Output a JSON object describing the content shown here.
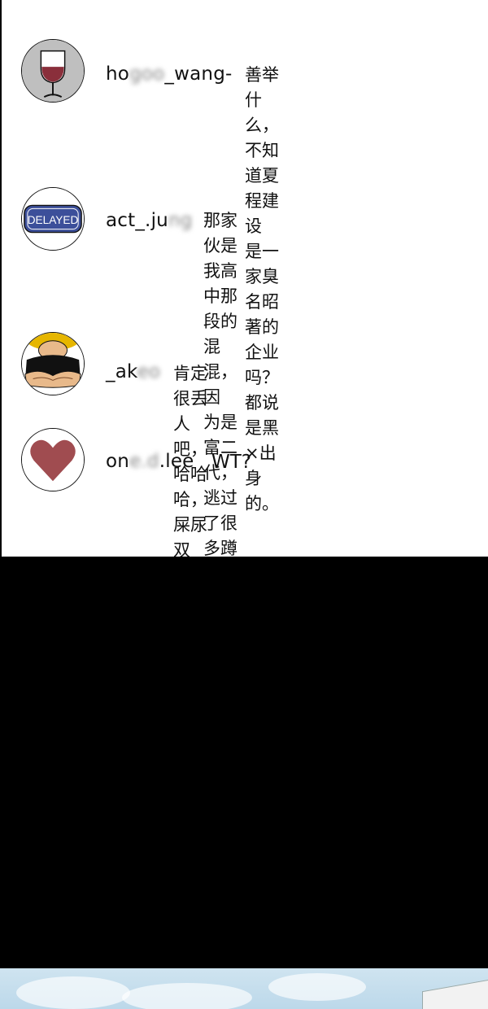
{
  "comments": [
    {
      "avatar_icon": "wine-glass-icon",
      "user_visible_start": "ho",
      "user_blurred": "goo",
      "user_visible_end": "_wang-",
      "text": "善举什么，不知道夏程建设\n是一家臭名昭著的企业吗？\n都说是黑×出身的。"
    },
    {
      "avatar_icon": "delayed-badge-icon",
      "avatar_label": "DELAYED",
      "user_visible_start": "act_.ju",
      "user_blurred": "ng",
      "user_visible_end": "",
      "text": "那家伙是我高中那段的混混，因\n为是富二代，逃过了很多蹲监狱\n的罪。"
    },
    {
      "avatar_icon": "muscle-man-icon",
      "user_visible_start": "_ak",
      "user_blurred": "eo",
      "user_visible_end": "",
      "text": "肯定很丢人吧，哈哈哈，\n屎尿双飞，可以可以。"
    },
    {
      "avatar_icon": "heart-icon",
      "user_visible_start": "on",
      "user_blurred": "e.d",
      "user_visible_end": ".lee",
      "text": "WT?"
    }
  ],
  "colors": {
    "wine": "#8a2f3b",
    "badge_blue": "#3c4f9a",
    "heart": "#a04c50",
    "skin": "#e8b98a",
    "background_dark": "#000000"
  }
}
